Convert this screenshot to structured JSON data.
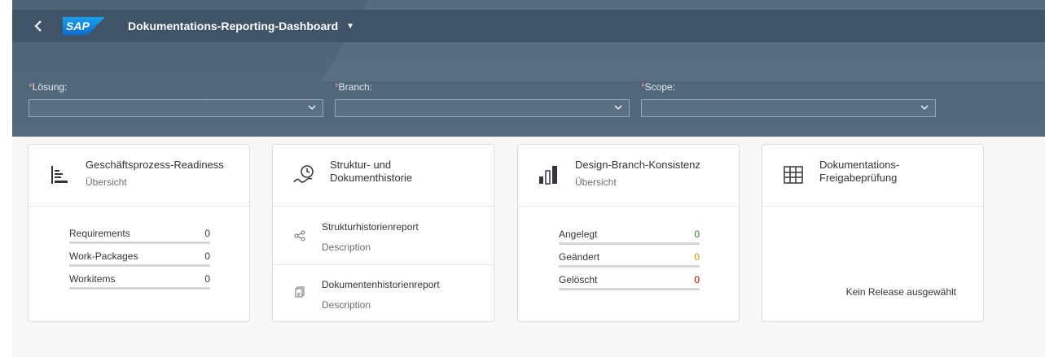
{
  "shellbar": {
    "logo_text": "SAP",
    "title": "Dokumentations-Reporting-Dashboard",
    "back_icon": "chevron-left-icon",
    "caret_icon": "caret-down-icon"
  },
  "filters": [
    {
      "required_marker": "*",
      "label": "Lösung:",
      "value": ""
    },
    {
      "required_marker": "*",
      "label": "Branch:",
      "value": ""
    },
    {
      "required_marker": "*",
      "label": "Scope:",
      "value": ""
    }
  ],
  "cards": {
    "readiness": {
      "title": "Geschäftsprozess-Readiness",
      "subtitle": "Übersicht",
      "icon": "list-align-icon",
      "rows": [
        {
          "label": "Requirements",
          "value": "0"
        },
        {
          "label": "Work-Packages",
          "value": "0"
        },
        {
          "label": "Workitems",
          "value": "0"
        }
      ]
    },
    "history": {
      "title_line1": "Struktur- und",
      "title_line2": "Dokumenthistorie",
      "icon": "history-icon",
      "reports": [
        {
          "name": "Strukturhistorienreport",
          "description": "Description",
          "icon": "share-nodes-icon"
        },
        {
          "name": "Dokumentenhistorienreport",
          "description": "Description",
          "icon": "documents-icon"
        }
      ]
    },
    "consistency": {
      "title": "Design-Branch-Konsistenz",
      "subtitle": "Übersicht",
      "icon": "bar-chart-icon",
      "rows": [
        {
          "label": "Angelegt",
          "value": "0",
          "color": "#2b7c2b"
        },
        {
          "label": "Geändert",
          "value": "0",
          "color": "#e78c07"
        },
        {
          "label": "Gelöscht",
          "value": "0",
          "color": "#bb0000"
        }
      ]
    },
    "release": {
      "title_line1": "Dokumentations-",
      "title_line2": "Freigabeprüfung",
      "icon": "table-grid-icon",
      "empty_text": "Kein Release ausgewählt"
    }
  },
  "colors": {
    "header_bg": "#536a7e",
    "shellbar_bg": "#3f5468",
    "sap_blue": "#0a6ed1",
    "text": "#32363a"
  }
}
